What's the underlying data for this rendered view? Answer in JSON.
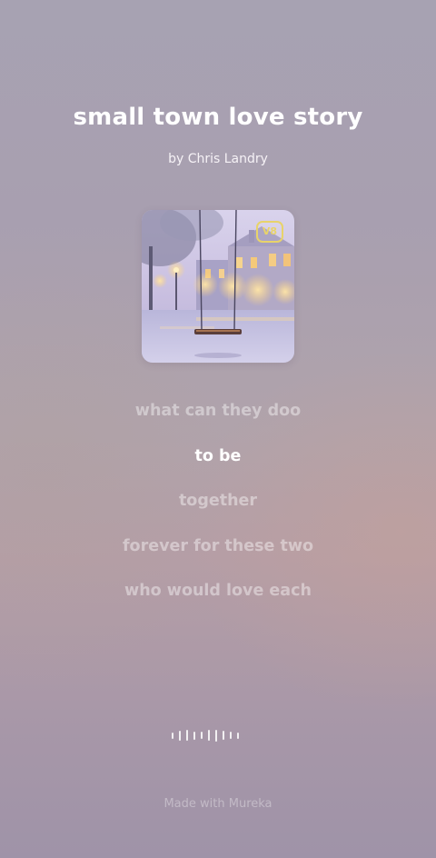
{
  "song": {
    "title": "small town love story",
    "artist": "by Chris Landry",
    "cover": {
      "badge": "V8"
    }
  },
  "lyrics": [
    {
      "text": "what can they doo",
      "active": false
    },
    {
      "text": "to be",
      "active": true
    },
    {
      "text": "together",
      "active": false
    },
    {
      "text": "forever for these two",
      "active": false
    },
    {
      "text": "who would love each",
      "active": false
    }
  ],
  "waveform": {
    "icon": "waveform-icon",
    "levels": [
      0.5,
      0.8,
      0.85,
      0.65,
      0.55,
      0.85,
      0.9,
      0.7,
      0.55,
      0.5
    ]
  },
  "footer": {
    "text": "Made with Mureka"
  }
}
